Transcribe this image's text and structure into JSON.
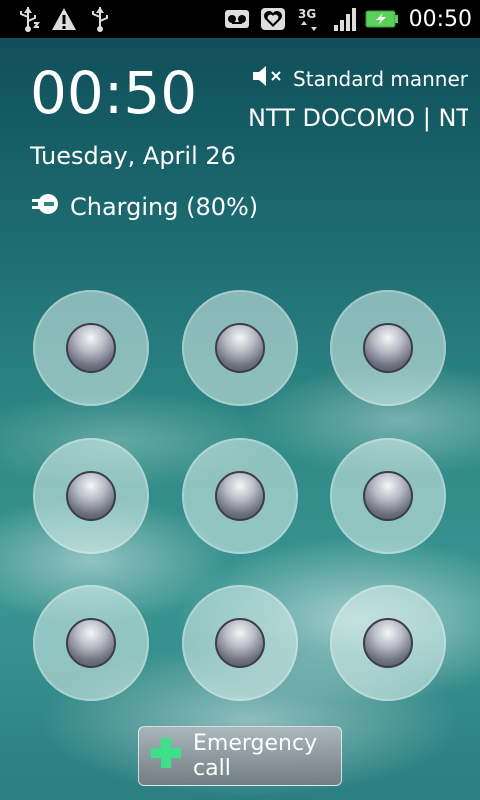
{
  "status_bar": {
    "left_icons": [
      "usb-debug-icon",
      "warning-icon",
      "usb-icon"
    ],
    "right_icons": [
      "voicemail-icon",
      "heart-icon",
      "3g-icon",
      "signal-icon",
      "battery-charging-icon"
    ],
    "network_type": "3G",
    "time": "00:50"
  },
  "lockscreen": {
    "clock": "00:50",
    "date": "Tuesday, April 26",
    "charging_text": "Charging (80%)",
    "sound_mode": "Standard manner",
    "carrier": "NTT DOCOMO | NTT DOCOMO"
  },
  "pattern": {
    "dots": [
      1,
      2,
      3,
      4,
      5,
      6,
      7,
      8,
      9
    ]
  },
  "emergency": {
    "label": "Emergency call"
  }
}
